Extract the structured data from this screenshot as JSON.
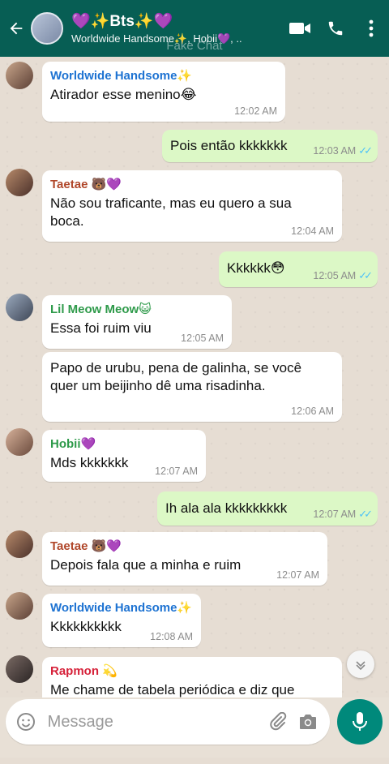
{
  "header": {
    "title": "💜✨Bts✨💜",
    "subtitle": "Worldwide Handsome✨, Hobii💜, ..",
    "watermark": "Fake Chat"
  },
  "icons": {
    "back": "back-arrow-icon",
    "video": "video-call-icon",
    "call": "phone-icon",
    "menu": "more-vert-icon",
    "emoji": "emoji-icon",
    "attach": "paperclip-icon",
    "camera": "camera-icon",
    "mic": "mic-icon",
    "scroll": "chevron-down-icon"
  },
  "colors": {
    "header": "#075e54",
    "incoming": "#ffffff",
    "outgoing": "#dcf8c6",
    "read_ticks": "#4fc3f7",
    "name_worldwide": "#1e73d2",
    "name_taetae": "#b0472a",
    "name_lil": "#2e9a4a",
    "name_hobii": "#2e9a4a",
    "name_rapmon": "#d6223a"
  },
  "messages": [
    {
      "dir": "in",
      "sender": "Worldwide Handsome✨",
      "text": "Atirador esse menino😂",
      "time": "12:02 AM"
    },
    {
      "dir": "out",
      "text": "Pois então kkkkkkk",
      "time": "12:03 AM"
    },
    {
      "dir": "in",
      "sender": "Taetae 🐻💜",
      "text": "Não sou traficante, mas eu quero a sua boca.",
      "time": "12:04 AM"
    },
    {
      "dir": "out",
      "text": "Kkkkkk😳",
      "time": "12:05 AM"
    },
    {
      "dir": "in",
      "sender": "Lil Meow Meow😺",
      "text": "Essa foi ruim viu",
      "time": "12:05 AM"
    },
    {
      "dir": "in",
      "text": "Papo de urubu, pena de galinha, se você quer um beijinho dê uma risadinha.",
      "time": "12:06 AM"
    },
    {
      "dir": "in",
      "sender": "Hobii💜",
      "text": "Mds kkkkkkk",
      "time": "12:07 AM"
    },
    {
      "dir": "out",
      "text": "Ih ala ala kkkkkkkkk",
      "time": "12:07 AM"
    },
    {
      "dir": "in",
      "sender": "Taetae 🐻💜",
      "text": "Depois fala que a minha e ruim",
      "time": "12:07 AM"
    },
    {
      "dir": "in",
      "sender": "Worldwide Handsome✨",
      "text": "Kkkkkkkkkk",
      "time": "12:08 AM"
    },
    {
      "dir": "in",
      "sender": "Rapmon 💫",
      "text": "Me chame de tabela periódica e diz que",
      "time": ""
    }
  ],
  "composer": {
    "placeholder": "Message"
  }
}
